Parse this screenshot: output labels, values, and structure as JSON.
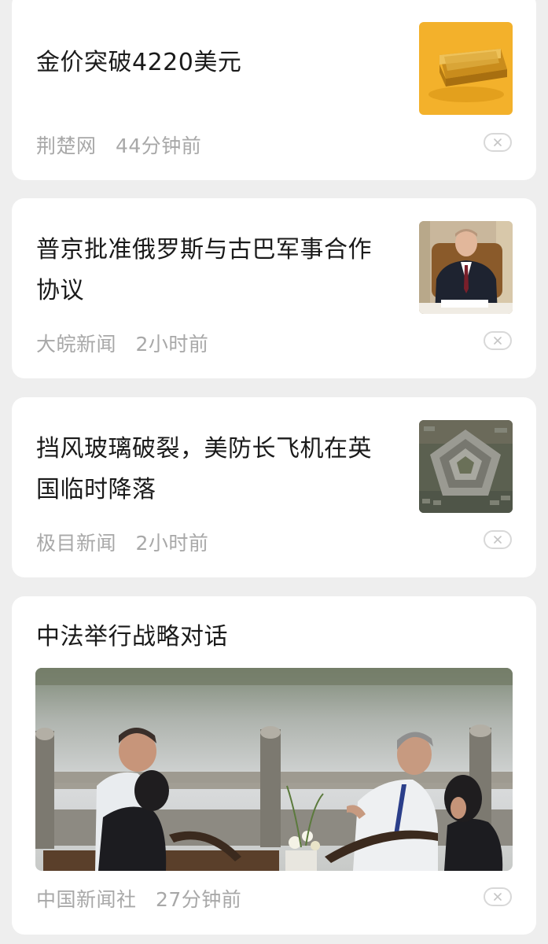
{
  "articles": [
    {
      "title": "金价突破4220美元",
      "source": "荆楚网",
      "time": "44分钟前",
      "thumbnail": "gold-bar"
    },
    {
      "title": "普京批准俄罗斯与古巴军事合作协议",
      "source": "大皖新闻",
      "time": "2小时前",
      "thumbnail": "person-at-desk"
    },
    {
      "title": "挡风玻璃破裂，美防长飞机在英国临时降落",
      "source": "极目新闻",
      "time": "2小时前",
      "thumbnail": "pentagon-aerial"
    },
    {
      "title": "中法举行战略对话",
      "source": "中国新闻社",
      "time": "27分钟前",
      "thumbnail": "lakeside-meeting"
    }
  ],
  "icons": {
    "dismiss": "close-icon"
  },
  "colors": {
    "background": "#eeeeee",
    "card": "#ffffff",
    "title": "#1a1a1a",
    "meta": "#a8a8a8",
    "gold_bg": "#f2b02a"
  }
}
